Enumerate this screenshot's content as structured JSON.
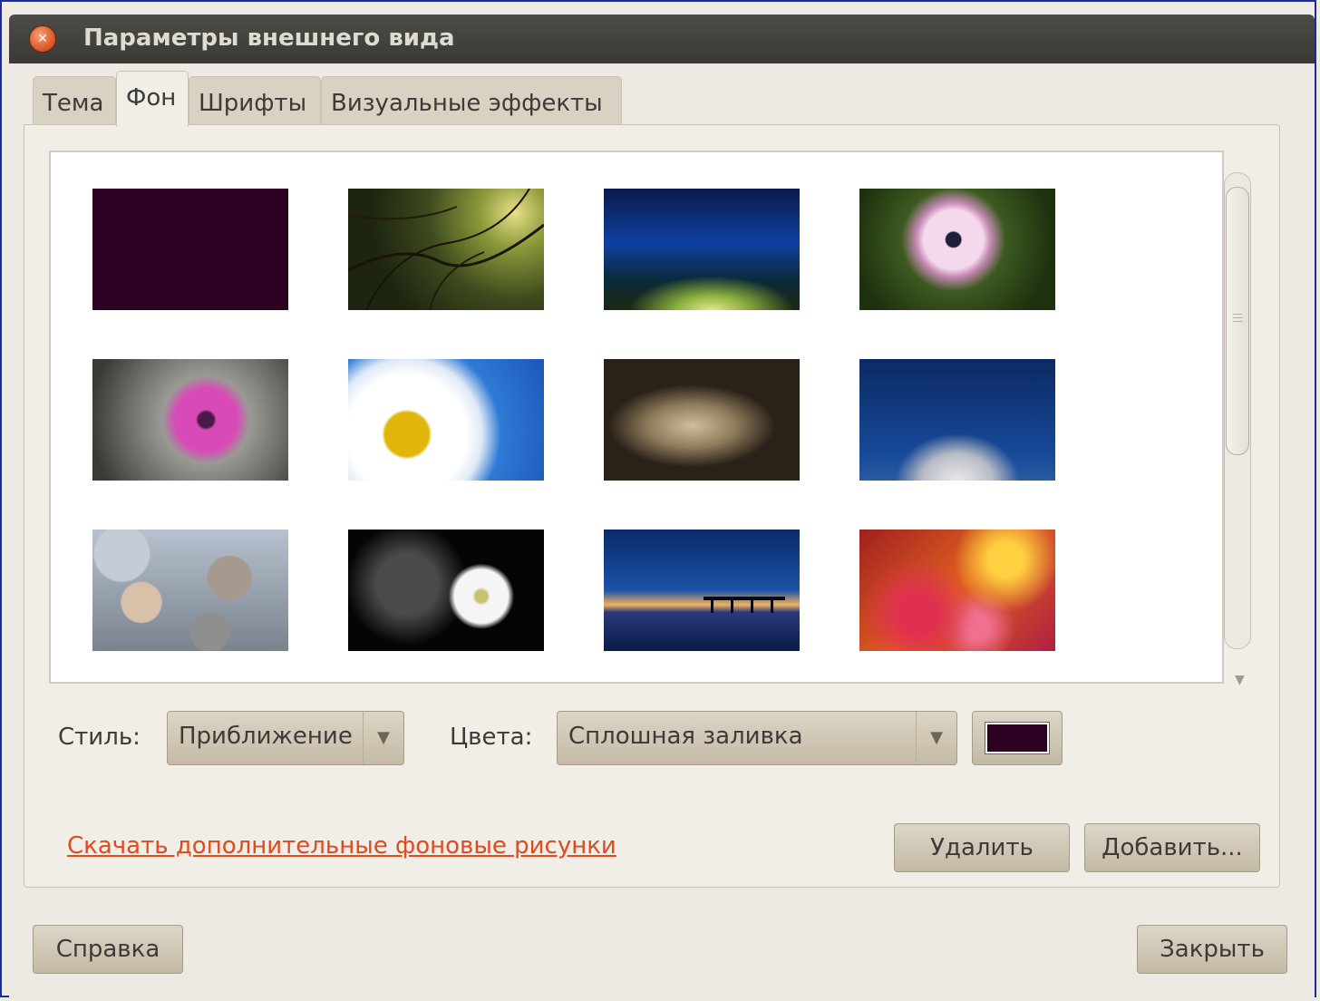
{
  "window": {
    "title": "Параметры внешнего вида",
    "close_icon": "close-icon"
  },
  "tabs": [
    {
      "label": "Тема",
      "active": false
    },
    {
      "label": "Фон",
      "active": true
    },
    {
      "label": "Шрифты",
      "active": false
    },
    {
      "label": "Визуальные эффекты",
      "active": false
    }
  ],
  "wallpapers": [
    {
      "name": "solid-aubergine"
    },
    {
      "name": "tree-canopy"
    },
    {
      "name": "blue-green-light-streaks"
    },
    {
      "name": "pink-daisy"
    },
    {
      "name": "magenta-flower"
    },
    {
      "name": "white-daisy-blue-sky"
    },
    {
      "name": "autumn-leaf-drops"
    },
    {
      "name": "dandelion"
    },
    {
      "name": "pebbles-in-ice"
    },
    {
      "name": "white-flower-dark"
    },
    {
      "name": "pier-at-dusk"
    },
    {
      "name": "warm-bokeh"
    }
  ],
  "style": {
    "label": "Стиль:",
    "value": "Приближение"
  },
  "colors": {
    "label": "Цвета:",
    "value": "Сплошная заливка",
    "swatch_color": "#2c0021"
  },
  "links": {
    "download": "Скачать дополнительные фоновые рисунки"
  },
  "buttons": {
    "remove": "Удалить",
    "add": "Добавить...",
    "help": "Справка",
    "close": "Закрыть"
  }
}
